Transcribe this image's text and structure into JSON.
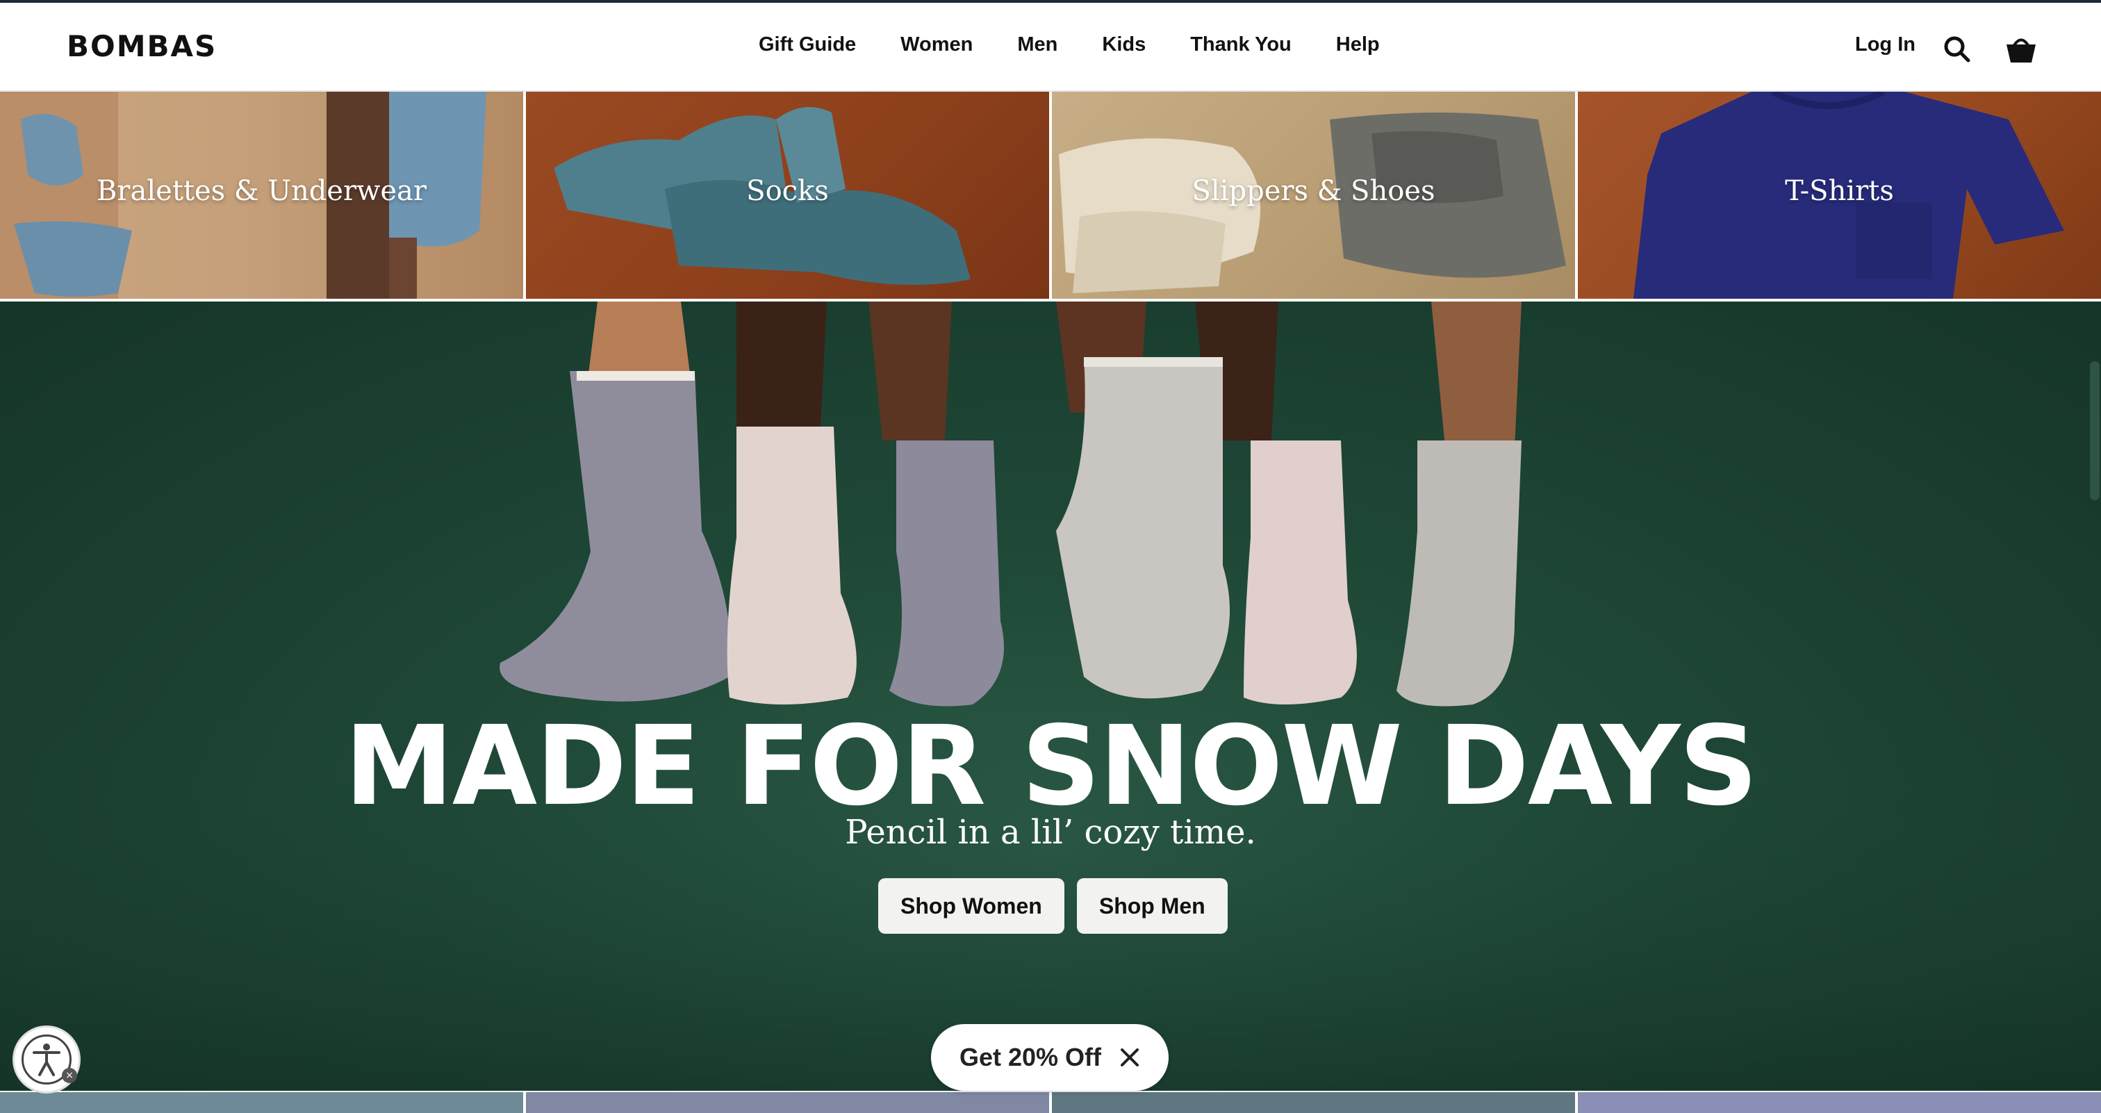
{
  "brand": {
    "logo_text": "BOMBAS"
  },
  "nav": {
    "items": [
      {
        "label": "Gift Guide"
      },
      {
        "label": "Women"
      },
      {
        "label": "Men"
      },
      {
        "label": "Kids"
      },
      {
        "label": "Thank You"
      },
      {
        "label": "Help"
      }
    ],
    "login_label": "Log In",
    "search_icon": "search-icon",
    "cart_icon": "basket-icon"
  },
  "categories": [
    {
      "label": "Bralettes & Underwear"
    },
    {
      "label": "Socks"
    },
    {
      "label": "Slippers & Shoes"
    },
    {
      "label": "T-Shirts"
    }
  ],
  "hero": {
    "headline": "MADE FOR SNOW DAYS",
    "subheadline": "Pencil in a lil’ cozy time.",
    "buttons": [
      {
        "label": "Shop Women"
      },
      {
        "label": "Shop Men"
      }
    ],
    "background_color": "#1f4837"
  },
  "promo": {
    "label": "Get 20% Off",
    "close_icon": "close-icon"
  },
  "accessibility": {
    "icon": "accessibility-icon"
  }
}
